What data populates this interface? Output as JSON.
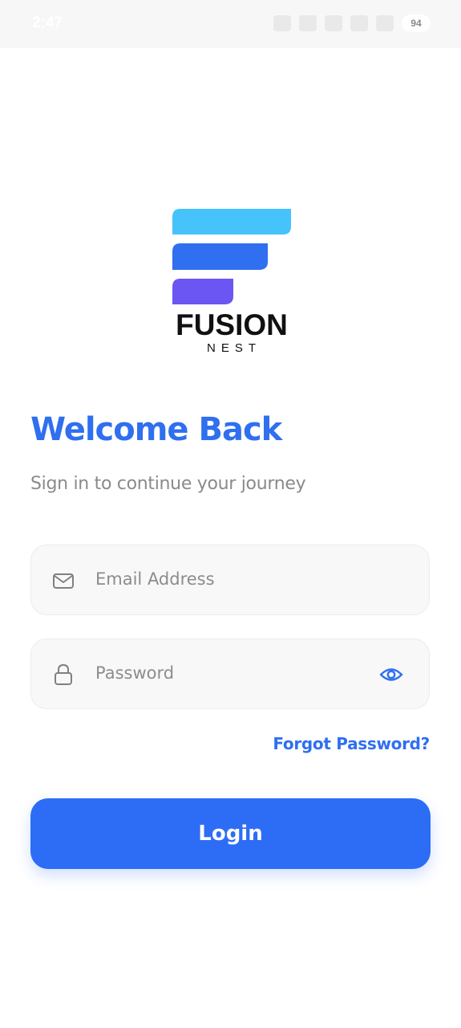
{
  "status_bar": {
    "time": "2:47",
    "battery": "94"
  },
  "logo": {
    "word": "FUSION",
    "sub": "NEST"
  },
  "welcome": {
    "title": "Welcome Back",
    "subtitle": "Sign in to continue your journey"
  },
  "form": {
    "email_placeholder": "Email Address",
    "email_value": "",
    "password_placeholder": "Password",
    "password_value": "",
    "forgot_label": "Forgot Password?",
    "login_label": "Login"
  },
  "icons": {
    "email": "mail-icon",
    "password": "lock-icon",
    "toggle": "eye-icon"
  },
  "colors": {
    "accent": "#2f6ff0",
    "button": "#2d6df6",
    "logo_top": "#46c3fb",
    "logo_mid": "#2f6ff0",
    "logo_bottom": "#6b55f3"
  }
}
